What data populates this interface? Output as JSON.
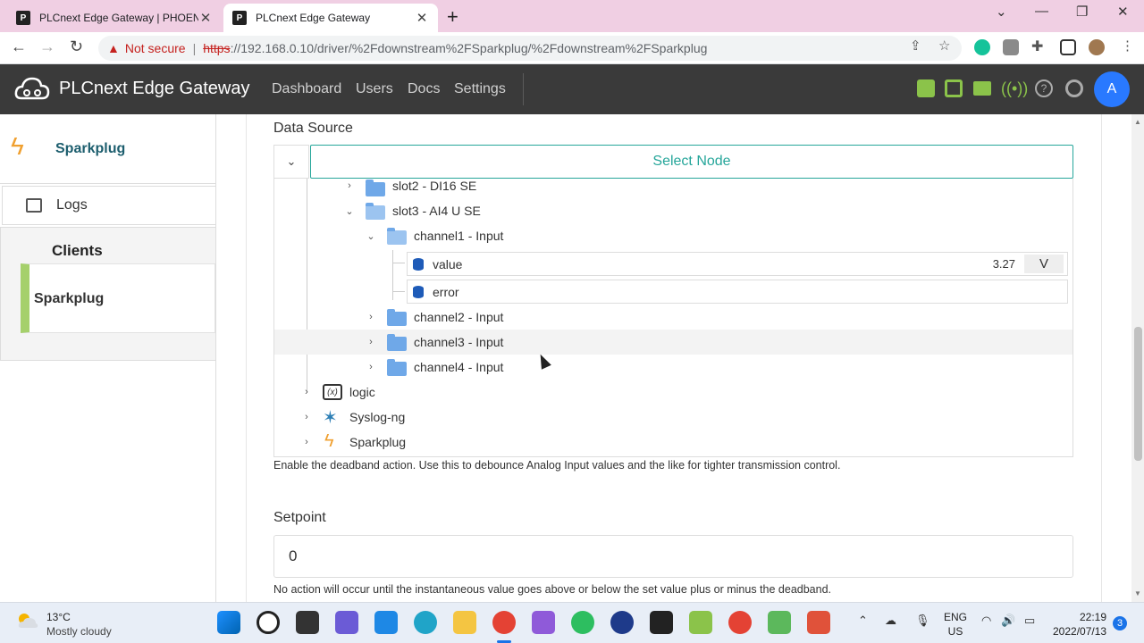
{
  "browser": {
    "tabs": [
      {
        "title": "PLCnext Edge Gateway | PHOENIX",
        "active": false
      },
      {
        "title": "PLCnext Edge Gateway",
        "active": true
      }
    ],
    "security_label": "Not secure",
    "url_scheme": "https",
    "url_rest": "://192.168.0.10/driver/%2Fdownstream%2FSparkplug/%2Fdownstream%2FSparkplug"
  },
  "app": {
    "brand": "PLCnext Edge Gateway",
    "nav": [
      "Dashboard",
      "Users",
      "Docs",
      "Settings"
    ],
    "avatar_initial": "A",
    "accent_color": "#26a69a"
  },
  "sidebar": {
    "driver_name": "Sparkplug",
    "logs_label": "Logs",
    "clients_heading": "Clients",
    "client_item": "Sparkplug"
  },
  "form": {
    "data_source_label": "Data Source",
    "select_node_label": "Select Node",
    "tree": {
      "slot2": "slot2 - DI16 SE",
      "slot3": "slot3 - AI4 U SE",
      "channel1": "channel1 - Input",
      "value_label": "value",
      "value_reading": "3.27",
      "value_unit": "V",
      "error_label": "error",
      "channel2": "channel2 - Input",
      "channel3": "channel3 - Input",
      "channel4": "channel4 - Input",
      "logic": "logic",
      "logic_icon": "(x)",
      "syslog": "Syslog-ng",
      "sparkplug": "Sparkplug"
    },
    "deadband_help": "Enable the deadband action. Use this to debounce Analog Input values and the like for tighter transmission control.",
    "setpoint_label": "Setpoint",
    "setpoint_value": "0",
    "setpoint_help": "No action will occur until the instantaneous value goes above or below the set value plus or minus the deadband."
  },
  "taskbar": {
    "temperature": "13°C",
    "condition": "Mostly cloudy",
    "lang_line1": "ENG",
    "lang_line2": "US",
    "time": "22:19",
    "date": "2022/07/13",
    "notifications": "3"
  }
}
